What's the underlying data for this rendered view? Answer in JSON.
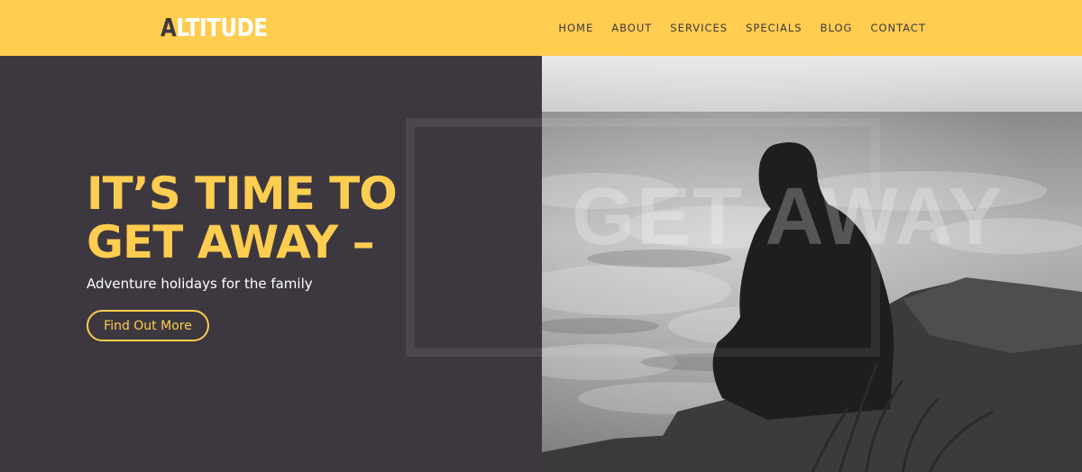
{
  "header": {
    "logo_first": "A",
    "logo_rest": "LTITUDE",
    "nav": [
      "HOME",
      "ABOUT",
      "SERVICES",
      "SPECIALS",
      "BLOG",
      "CONTACT"
    ]
  },
  "hero": {
    "headline_line1": "IT’S TIME TO",
    "headline_line2": "GET AWAY –",
    "subtitle": "Adventure holidays for the family",
    "button_label": "Find Out More",
    "ghost_text": "GET AWAY"
  },
  "colors": {
    "accent": "#ffcd4f",
    "dark": "#3d3840"
  }
}
